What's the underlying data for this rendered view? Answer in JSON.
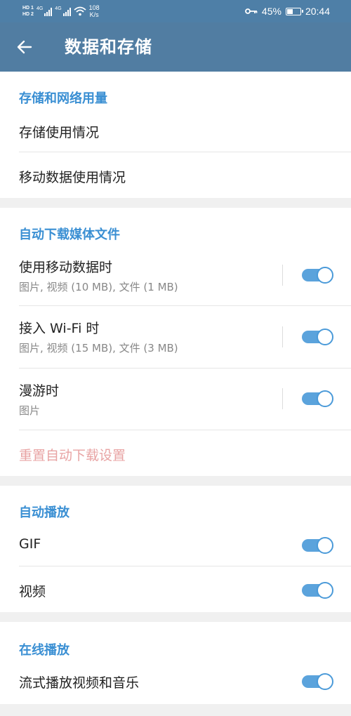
{
  "status_bar": {
    "sim1": "HD 1",
    "sim2": "HD 2",
    "net1": "4G",
    "net2": "4G",
    "speed_value": "108",
    "speed_unit": "K/s",
    "battery_percent": "45%",
    "battery_level": 0.45,
    "time": "20:44",
    "icons": [
      "signal-icon",
      "wifi-icon",
      "key-icon",
      "battery-icon"
    ]
  },
  "app_bar": {
    "back_icon": "arrow-left-icon",
    "title": "数据和存储"
  },
  "storage_section": {
    "title": "存储和网络用量",
    "items": [
      {
        "label": "存储使用情况"
      },
      {
        "label": "移动数据使用情况"
      }
    ]
  },
  "auto_download_section": {
    "title": "自动下载媒体文件",
    "items": [
      {
        "label": "使用移动数据时",
        "sub": "图片, 视频 (10 MB), 文件 (1 MB)",
        "enabled": true
      },
      {
        "label": "接入 Wi-Fi 时",
        "sub": "图片, 视频 (15 MB), 文件 (3 MB)",
        "enabled": true
      },
      {
        "label": "漫游时",
        "sub": "图片",
        "enabled": true
      }
    ],
    "reset_label": "重置自动下载设置"
  },
  "autoplay_section": {
    "title": "自动播放",
    "items": [
      {
        "label": "GIF",
        "enabled": true
      },
      {
        "label": "视频",
        "enabled": true
      }
    ]
  },
  "streaming_section": {
    "title": "在线播放",
    "items": [
      {
        "label": "流式播放视频和音乐",
        "enabled": true
      }
    ]
  },
  "colors": {
    "app_bar": "#517da2",
    "status_bar": "#4e7fa7",
    "section_title": "#3a8fd3",
    "toggle_on": "#5ba3dc",
    "reset_text": "#e8a3a3",
    "background": "#f0f0f0"
  }
}
